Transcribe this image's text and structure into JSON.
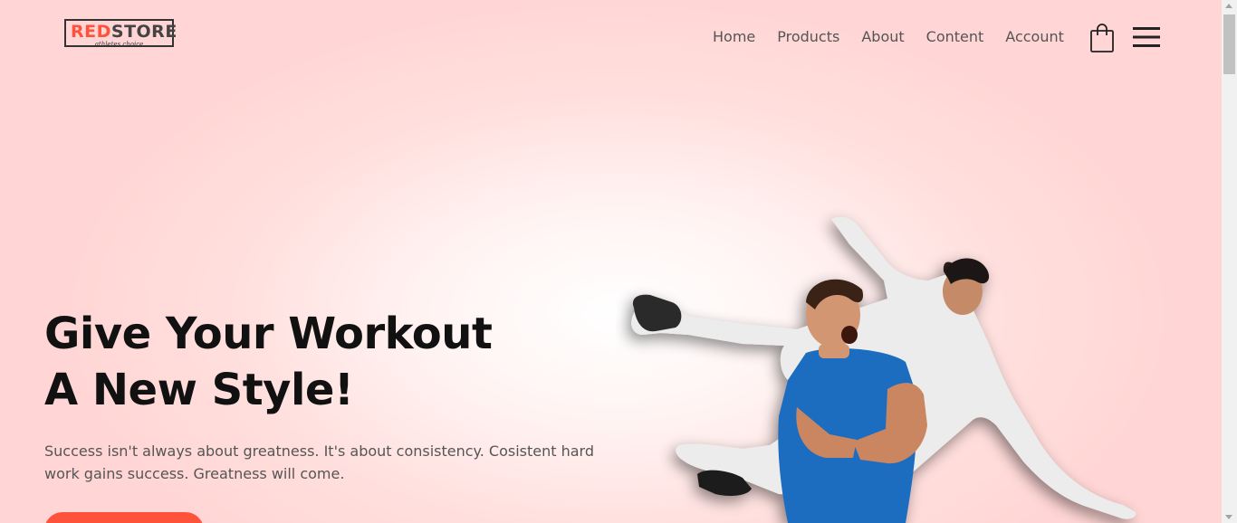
{
  "header": {
    "logo": {
      "brand_prefix": "RED",
      "brand_suffix": "STORE",
      "tagline": "athletes choice"
    },
    "nav": [
      "Home",
      "Products",
      "About",
      "Content",
      "Account"
    ],
    "cart_icon": "shopping-bag-icon",
    "menu_icon": "hamburger-menu-icon"
  },
  "hero": {
    "title_line1": "Give Your Workout",
    "title_line2": "A New Style!",
    "subtitle": "Success isn't always about greatness. It's about consistency. Cosistent hard work gains success. Greatness will come.",
    "cta_label": "",
    "image": "two-football-players-celebrating"
  },
  "colors": {
    "accent": "#ff523b",
    "text_dark": "#111111",
    "text_muted": "#555555",
    "bg_pink": "#ffd6d5"
  }
}
